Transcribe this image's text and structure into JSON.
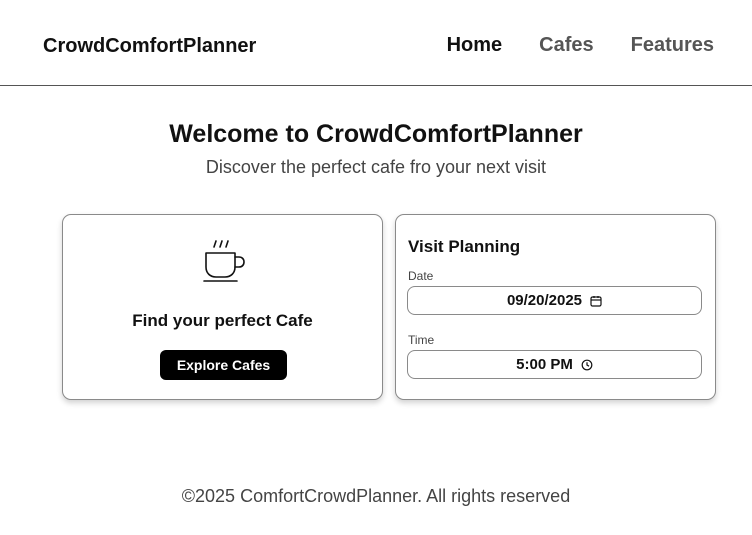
{
  "header": {
    "brand": "CrowdComfortPlanner",
    "nav": [
      {
        "label": "Home",
        "active": true
      },
      {
        "label": "Cafes",
        "active": false
      },
      {
        "label": "Features",
        "active": false
      }
    ]
  },
  "hero": {
    "title": "Welcome to CrowdComfortPlanner",
    "subtitle": "Discover the perfect cafe fro your next visit"
  },
  "find_card": {
    "icon": "coffee-cup-icon",
    "title": "Find your perfect Cafe",
    "button_label": "Explore Cafes"
  },
  "visit_card": {
    "title": "Visit Planning",
    "date_label": "Date",
    "date_value": "09/20/2025",
    "date_icon": "calendar-icon",
    "time_label": "Time",
    "time_value": "5:00 PM",
    "time_icon": "clock-icon"
  },
  "footer": {
    "text": "©2025 ComfortCrowdPlanner. All rights reserved"
  },
  "colors": {
    "primary_text": "#111111",
    "nav_inactive": "#555555",
    "button_bg": "#000000",
    "button_text": "#ffffff"
  }
}
